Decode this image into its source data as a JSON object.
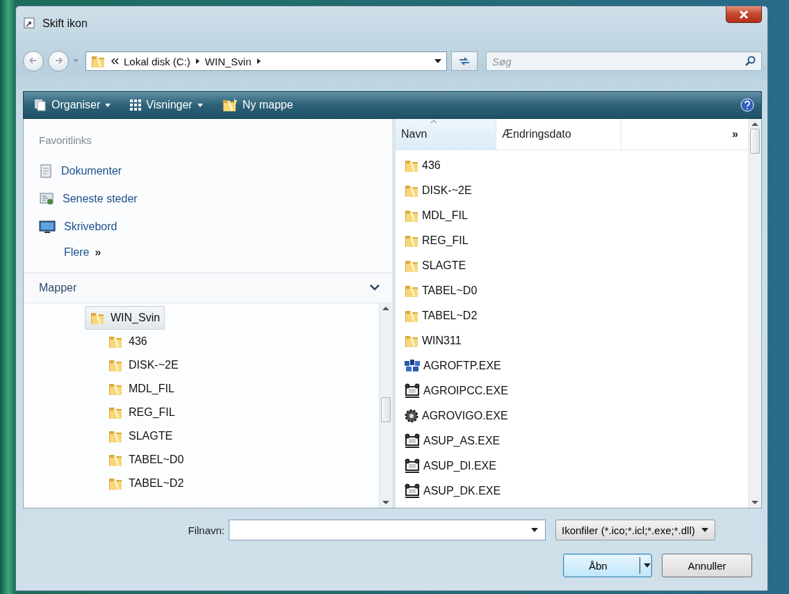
{
  "window": {
    "title": "Skift ikon"
  },
  "address": {
    "path": [
      "Lokal disk (C:)",
      "WIN_Svin"
    ]
  },
  "search": {
    "placeholder": "Søg"
  },
  "toolbar": [
    {
      "label": "Organiser",
      "kind": "organise",
      "dropdown": true
    },
    {
      "label": "Visninger",
      "kind": "views",
      "dropdown": true
    },
    {
      "label": "Ny mappe",
      "kind": "new-folder",
      "dropdown": false
    }
  ],
  "favorites": {
    "heading": "Favoritlinks",
    "items": [
      {
        "label": "Dokumenter",
        "kind": "documents"
      },
      {
        "label": "Seneste steder",
        "kind": "recent"
      },
      {
        "label": "Skrivebord",
        "kind": "desktop"
      }
    ],
    "more": {
      "label": "Flere",
      "glyph": "»"
    }
  },
  "folders": {
    "heading": "Mapper",
    "tree": [
      {
        "label": "WIN_Svin",
        "selected": true,
        "children": [
          {
            "label": "436",
            "selected": false
          },
          {
            "label": "DISK-~2E",
            "selected": false
          },
          {
            "label": "MDL_FIL",
            "selected": false
          },
          {
            "label": "REG_FIL",
            "selected": false
          },
          {
            "label": "SLAGTE",
            "selected": false
          },
          {
            "label": "TABEL~D0",
            "selected": false
          },
          {
            "label": "TABEL~D2",
            "selected": false
          }
        ]
      }
    ]
  },
  "columns": [
    {
      "label": "Navn",
      "sorted": true
    },
    {
      "label": "Ændringsdato",
      "sorted": false
    }
  ],
  "columns_more": "»",
  "files": [
    {
      "name": "436",
      "kind": "folder"
    },
    {
      "name": "DISK-~2E",
      "kind": "folder"
    },
    {
      "name": "MDL_FIL",
      "kind": "folder"
    },
    {
      "name": "REG_FIL",
      "kind": "folder"
    },
    {
      "name": "SLAGTE",
      "kind": "folder"
    },
    {
      "name": "TABEL~D0",
      "kind": "folder"
    },
    {
      "name": "TABEL~D2",
      "kind": "folder"
    },
    {
      "name": "WIN311",
      "kind": "folder"
    },
    {
      "name": "AGROFTP.EXE",
      "kind": "blocks"
    },
    {
      "name": "AGROIPCC.EXE",
      "kind": "robot"
    },
    {
      "name": "AGROVIGO.EXE",
      "kind": "gear"
    },
    {
      "name": "ASUP_AS.EXE",
      "kind": "robot"
    },
    {
      "name": "ASUP_DI.EXE",
      "kind": "robot"
    },
    {
      "name": "ASUP_DK.EXE",
      "kind": "robot"
    }
  ],
  "footer": {
    "filename_label": "Filnavn:",
    "filetype": "Ikonfiler (*.ico;*.icl;*.exe;*.dll)",
    "buttons": [
      {
        "label": "Åbn",
        "kind": "split",
        "default": true
      },
      {
        "label": "Annuller",
        "kind": "plain",
        "default": false
      }
    ]
  }
}
